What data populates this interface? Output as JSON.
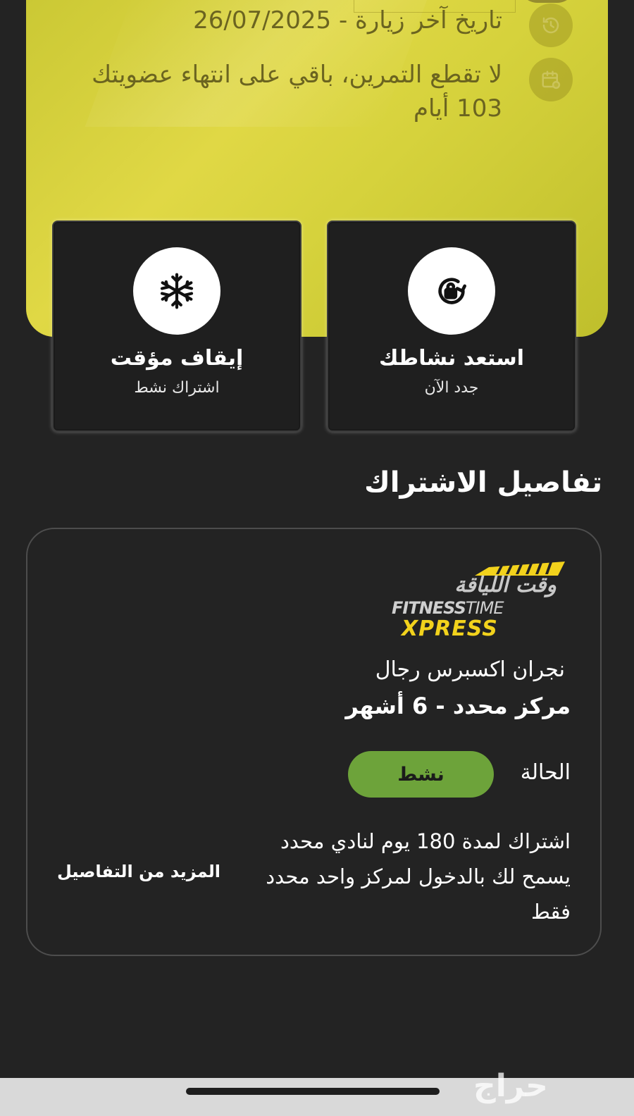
{
  "membership_card": {
    "last_visit": "تاريخ آخر زيارة - 26/07/2025",
    "remaining": "لا تقطع التمرين، باقي على انتهاء عضويتك 103 أيام"
  },
  "actions": {
    "renew": {
      "title": "استعد نشاطك",
      "subtitle": "جدد الآن"
    },
    "freeze": {
      "title": "إيقاف مؤقت",
      "subtitle": "اشتراك نشط"
    }
  },
  "subscription_details": {
    "heading": "تفاصيل الاشتراك",
    "logo": {
      "arabic": "وقت اللياقة",
      "fitness": "FITNESS",
      "time": "TIME",
      "xpress": "XPRESS"
    },
    "club_name": "نجران اكسبرس رجال",
    "plan_name": "مركز محدد - 6 أشهر",
    "status_label": "الحالة",
    "status_value": "نشط",
    "status_color": "#6da33a",
    "description": "اشتراك لمدة 180 يوم لنادي محدد يسمح لك بالدخول لمركز واحد محدد فقط",
    "more_details": "المزيد من التفاصيل"
  },
  "watermark": "حراج",
  "colors": {
    "background": "#232323",
    "card_yellow": "#e0d845",
    "status_green": "#6da33a"
  },
  "icons": [
    "refresh-lock-icon",
    "snowflake-icon",
    "history-icon",
    "calendar-icon"
  ]
}
